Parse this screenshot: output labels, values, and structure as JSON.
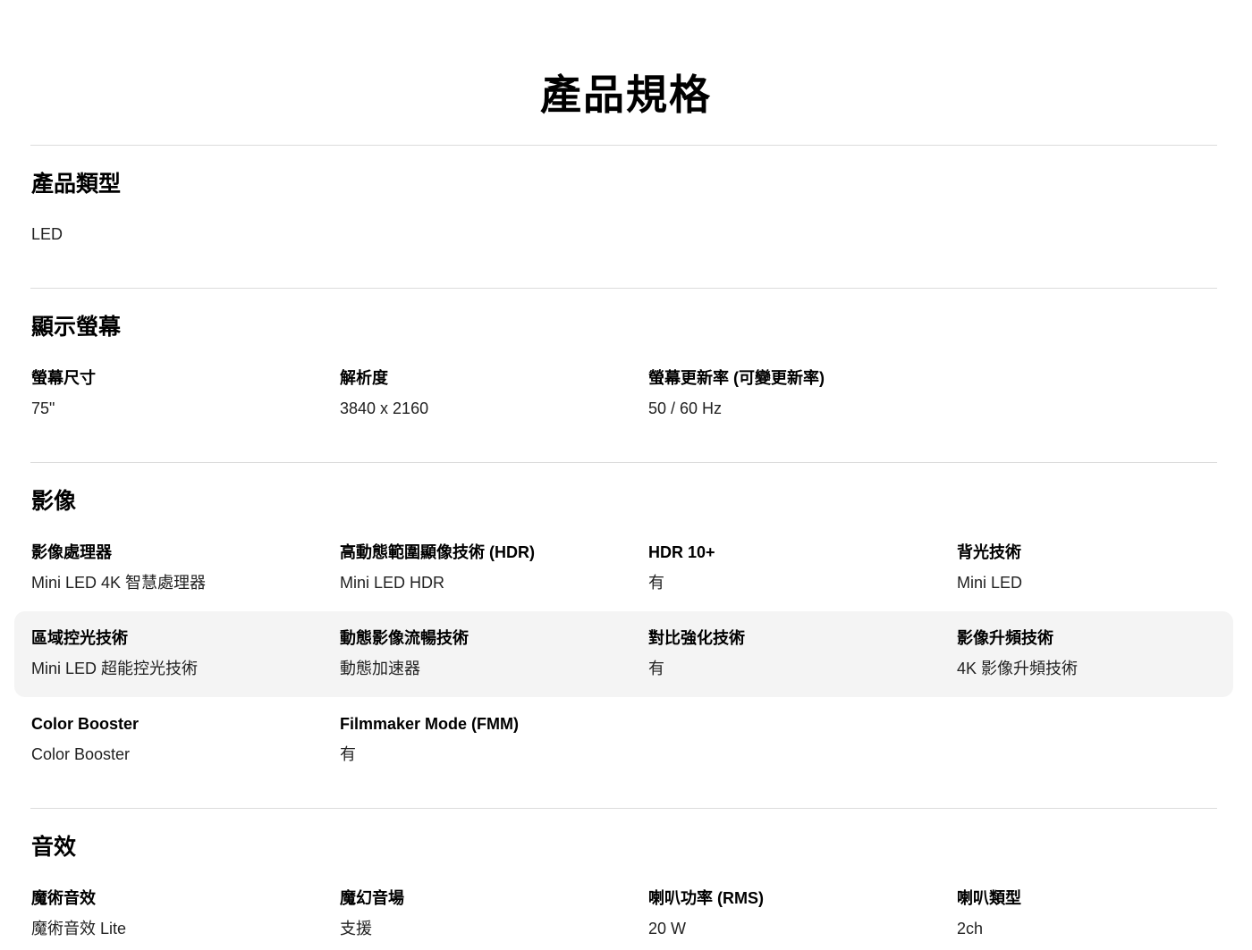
{
  "page": {
    "title": "產品規格"
  },
  "sections": [
    {
      "title": "產品類型",
      "rows": [
        [
          {
            "value": "LED"
          }
        ]
      ]
    },
    {
      "title": "顯示螢幕",
      "rows": [
        [
          {
            "label": "螢幕尺寸",
            "value": "75\""
          },
          {
            "label": "解析度",
            "value": "3840 x 2160"
          },
          {
            "label": "螢幕更新率 (可變更新率)",
            "value": "50 / 60 Hz"
          }
        ]
      ]
    },
    {
      "title": "影像",
      "rows": [
        [
          {
            "label": "影像處理器",
            "value": "Mini LED 4K 智慧處理器"
          },
          {
            "label": "高動態範圍顯像技術 (HDR)",
            "value": "Mini LED HDR"
          },
          {
            "label": "HDR 10+",
            "value": "有"
          },
          {
            "label": "背光技術",
            "value": "Mini LED"
          }
        ],
        [
          {
            "label": "區域控光技術",
            "value": "Mini LED 超能控光技術"
          },
          {
            "label": "動態影像流暢技術",
            "value": "動態加速器"
          },
          {
            "label": "對比強化技術",
            "value": "有"
          },
          {
            "label": "影像升頻技術",
            "value": "4K 影像升頻技術"
          }
        ],
        [
          {
            "label": "Color Booster",
            "value": "Color Booster"
          },
          {
            "label": "Filmmaker Mode (FMM)",
            "value": "有"
          }
        ]
      ]
    },
    {
      "title": "音效",
      "rows": [
        [
          {
            "label": "魔術音效",
            "value": "魔術音效 Lite"
          },
          {
            "label": "魔幻音場",
            "value": "支援"
          },
          {
            "label": "喇叭功率 (RMS)",
            "value": "20 W"
          },
          {
            "label": "喇叭類型",
            "value": "2ch"
          }
        ]
      ]
    }
  ]
}
